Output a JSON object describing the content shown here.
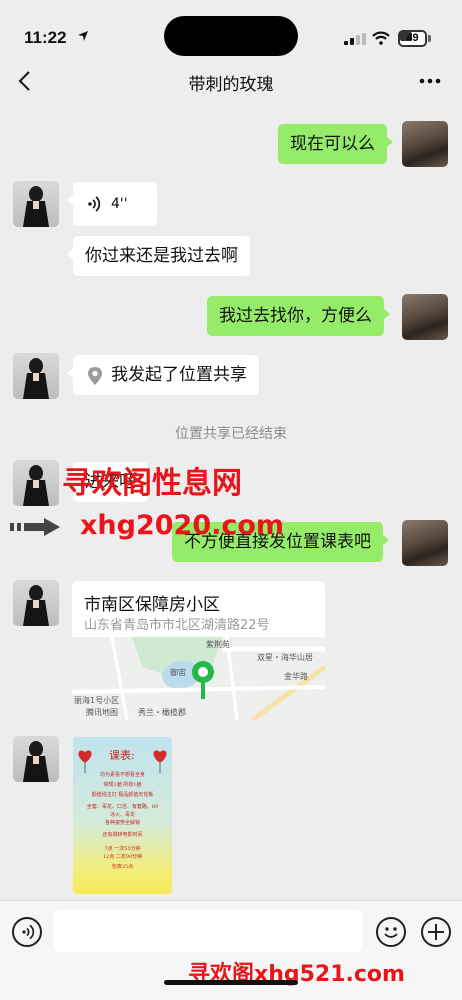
{
  "status": {
    "time": "11:22",
    "battery": "49",
    "battery_level": 0.49
  },
  "nav": {
    "title": "带刺的玫瑰",
    "back_icon": "chevron-left-icon",
    "more_icon": "more-dots-icon"
  },
  "messages": [
    {
      "side": "self",
      "type": "text",
      "text": "现在可以么"
    },
    {
      "side": "other",
      "type": "voice",
      "duration": "4''"
    },
    {
      "side": "other",
      "type": "text",
      "text": "你过来还是我过去啊"
    },
    {
      "side": "self",
      "type": "text",
      "text": "我过去找你，方便么"
    },
    {
      "side": "other",
      "type": "location_share",
      "text": "我发起了位置共享"
    },
    {
      "type": "system",
      "text": "位置共享已经结束"
    },
    {
      "side": "other",
      "type": "text",
      "text": "进来吧"
    },
    {
      "side": "self",
      "type": "text",
      "text": "不方便直接发位置课表吧"
    },
    {
      "side": "other",
      "type": "location",
      "title": "市南区保障房小区",
      "address": "山东省青岛市市北区湖清路22号",
      "map_labels": [
        "紫荆苑",
        "双星・海华山居",
        "御宙",
        "金华路",
        "丽海1号小区",
        "腾讯地图",
        "秀兰・橄榄郡"
      ]
    },
    {
      "side": "other",
      "type": "image",
      "title": "课表:",
      "lines": [
        "均为素看不想看全身",
        "常规1趟  所有1趟",
        "颜值线主打  极品颜值天花板",
        "全套、毒龙、口活、有套路、69",
        "冰火、毒龙",
        "各种姿势全解锁",
        "还有跳转电影时间",
        "7点  一次55分钟",
        "12点  二次90分钟",
        "包夜25点"
      ]
    }
  ],
  "input": {
    "placeholder": "",
    "voice_icon": "voice-icon",
    "emoji_icon": "emoji-icon",
    "add_icon": "plus-icon"
  },
  "watermarks": {
    "top": "寻欢阁性息网",
    "middle": "xhg2020.com",
    "bottom": "寻欢阁xhg521.com"
  },
  "colors": {
    "self_bubble": "#95ec69",
    "other_bubble": "#ffffff",
    "background": "#ededed",
    "watermark": "#e8151b"
  }
}
